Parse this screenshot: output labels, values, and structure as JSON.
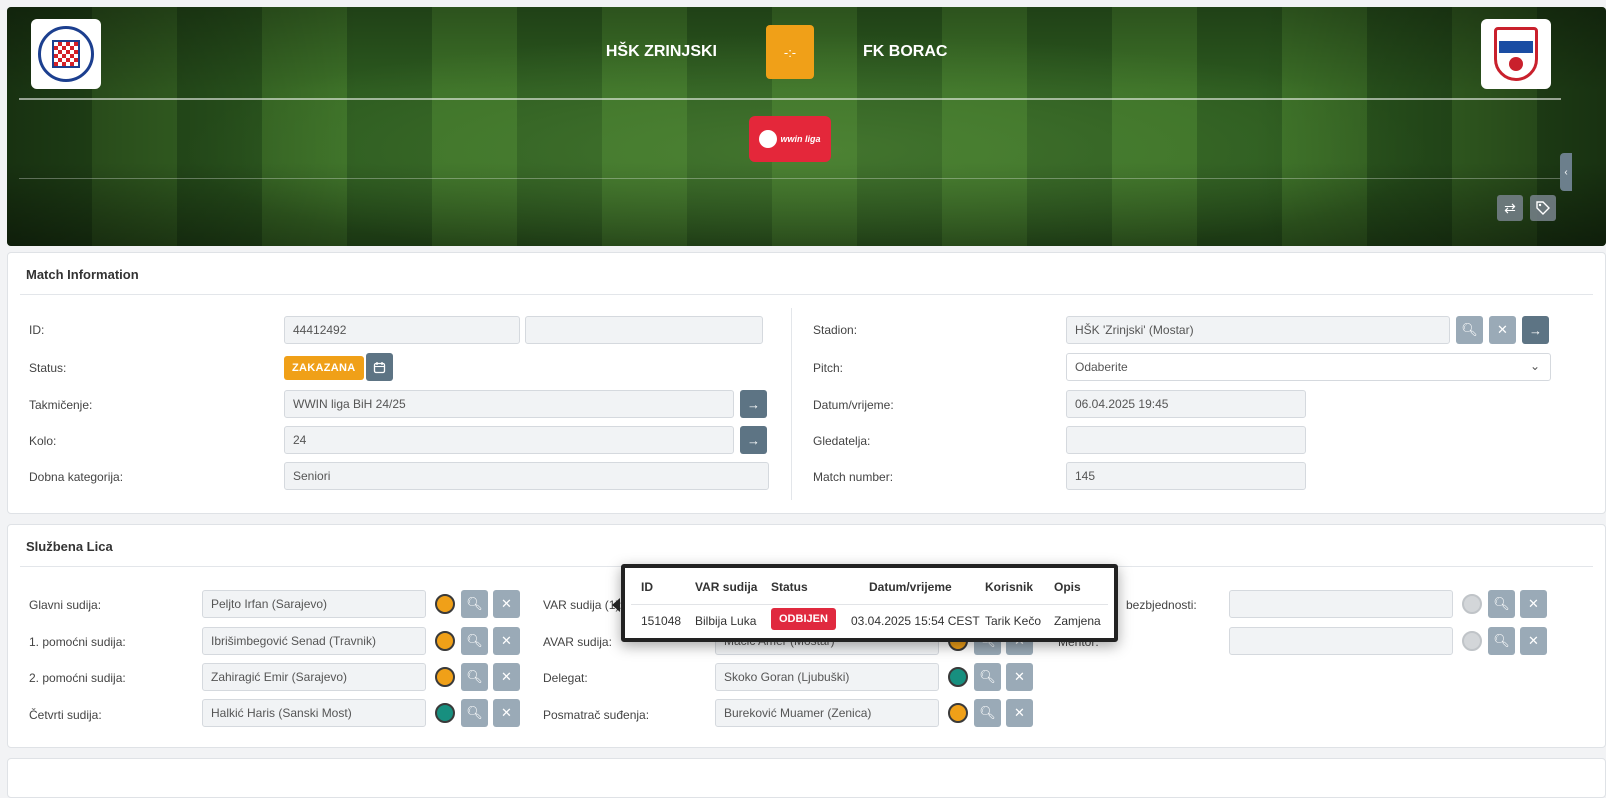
{
  "hero": {
    "home_team": "HŠK ZRINJSKI",
    "away_team": "FK BORAC",
    "score": "-:-",
    "home_logo_icon": "zrinjski-crest-icon",
    "away_logo_icon": "borac-shield-icon",
    "league_logo_text": "wwin liga",
    "swap_icon": "swap-arrows-icon",
    "tag_icon": "tag-icon",
    "side_tab_icon": "chevron-left-icon"
  },
  "match_info": {
    "title": "Match Information",
    "left": {
      "id_label": "ID:",
      "id_value": "44412492",
      "id_extra": "",
      "status_label": "Status:",
      "status_value": "ZAKAZANA",
      "competition_label": "Takmičenje:",
      "competition_value": "WWIN liga BiH 24/25",
      "round_label": "Kolo:",
      "round_value": "24",
      "age_label": "Dobna kategorija:",
      "age_value": "Seniori"
    },
    "right": {
      "stadium_label": "Stadion:",
      "stadium_value": "HŠK 'Zrinjski' (Mostar)",
      "pitch_label": "Pitch:",
      "pitch_value": "Odaberite",
      "datetime_label": "Datum/vrijeme:",
      "datetime_value": "06.04.2025 19:45",
      "spectators_label": "Gledatelja:",
      "spectators_value": "",
      "match_number_label": "Match number:",
      "match_number_value": "145"
    }
  },
  "officials": {
    "title": "Službena Lica",
    "col1": [
      {
        "label": "Glavni sudija:",
        "value": "Peljto Irfan (Sarajevo)",
        "status": "orange"
      },
      {
        "label": "1. pomoćni sudija:",
        "value": "Ibrišimbegović Senad (Travnik)",
        "status": "orange"
      },
      {
        "label": "2. pomoćni sudija:",
        "value": "Zahiragić Emir (Sarajevo)",
        "status": "orange"
      },
      {
        "label": "Četvrti sudija:",
        "value": "Halkić Haris (Sanski Most)",
        "status": "teal"
      }
    ],
    "col2": [
      {
        "label": "VAR sudija (1):",
        "value": "",
        "status": "orange"
      },
      {
        "label": "AVAR sudija:",
        "value": "Mačić Amer (Mostar)",
        "status": "orange"
      },
      {
        "label": "Delegat:",
        "value": "Skoko Goran (Ljubuški)",
        "status": "teal"
      },
      {
        "label": "Posmatrač suđenja:",
        "value": "Bureković Muamer (Zenica)",
        "status": "orange"
      }
    ],
    "col3": [
      {
        "label": "bezbjednosti:",
        "value": "",
        "status": "grey"
      },
      {
        "label": "Mentor:",
        "value": "",
        "status": "grey"
      }
    ]
  },
  "var_popup": {
    "headers": [
      "ID",
      "VAR sudija",
      "Status",
      "Datum/vrijeme",
      "Korisnik",
      "Opis"
    ],
    "row": {
      "id": "151048",
      "referee": "Bilbija Luka",
      "status": "ODBIJEN",
      "datetime": "03.04.2025 15:54 CEST",
      "user": "Tarik Kečo",
      "description": "Zamjena"
    }
  },
  "colors": {
    "accent_orange": "#f0a018",
    "refused_red": "#e0293f",
    "teal": "#178f7f",
    "button_grey": "#9aaab7",
    "button_dark": "#5d7484"
  }
}
